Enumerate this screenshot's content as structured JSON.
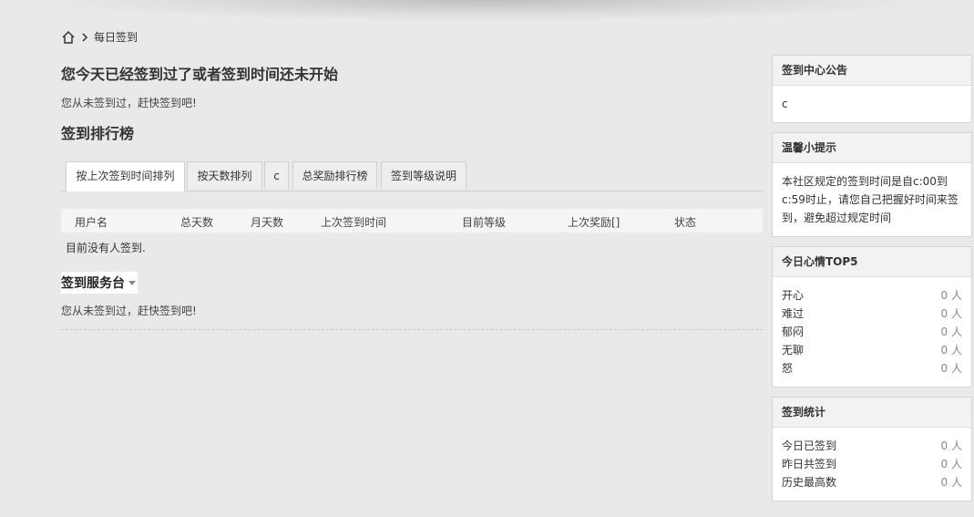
{
  "breadcrumb": {
    "current": "每日签到"
  },
  "main": {
    "headline": "您今天已经签到过了或者签到时间还未开始",
    "not_signed_msg": "您从未签到过，赶快签到吧!",
    "rank_title": "签到排行榜",
    "tabs": [
      {
        "label": "按上次签到时间排列"
      },
      {
        "label": "按天数排列"
      },
      {
        "label": "c"
      },
      {
        "label": "总奖励排行榜"
      },
      {
        "label": "签到等级说明"
      }
    ],
    "table": {
      "headers": [
        "用户名",
        "总天数",
        "月天数",
        "上次签到时间",
        "目前等级",
        "上次奖励[]",
        "状态"
      ],
      "empty": "目前没有人签到."
    },
    "service_title": "签到服务台",
    "service_msg": "您从未签到过，赶快签到吧!"
  },
  "sidebar": {
    "notice": {
      "title": "签到中心公告",
      "body": "c"
    },
    "tip": {
      "title": "温馨小提示",
      "body": "本社区规定的签到时间是自c:00到c:59时止，请您自己把握好时间来签到，避免超过规定时间"
    },
    "mood": {
      "title": "今日心情TOP5",
      "rows": [
        {
          "label": "开心",
          "value": "0 人"
        },
        {
          "label": "难过",
          "value": "0 人"
        },
        {
          "label": "郁闷",
          "value": "0 人"
        },
        {
          "label": "无聊",
          "value": "0 人"
        },
        {
          "label": "怒",
          "value": "0 人"
        }
      ]
    },
    "stats": {
      "title": "签到统计",
      "rows": [
        {
          "label": "今日已签到",
          "value": "0 人"
        },
        {
          "label": "昨日共签到",
          "value": "0 人"
        },
        {
          "label": "历史最高数",
          "value": "0 人"
        }
      ]
    }
  }
}
